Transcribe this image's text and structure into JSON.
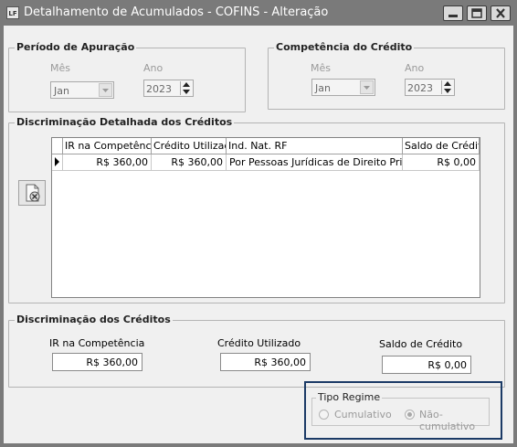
{
  "window": {
    "app_icon_text": "LF",
    "title": "Detalhamento de Acumulados - COFINS - Alteração"
  },
  "periodo": {
    "title": "Período de Apuração",
    "mes_label": "Mês",
    "mes_value": "Jan",
    "ano_label": "Ano",
    "ano_value": "2023"
  },
  "competencia": {
    "title": "Competência do Crédito",
    "mes_label": "Mês",
    "mes_value": "Jan",
    "ano_label": "Ano",
    "ano_value": "2023"
  },
  "detalhada": {
    "title": "Discriminação Detalhada dos Créditos",
    "columns": [
      "IR na Competência",
      "Crédito Utilizado",
      "Ind. Nat. RF",
      "Saldo de Crédito"
    ],
    "rows": [
      [
        "R$ 360,00",
        "R$ 360,00",
        "Por Pessoas Jurídicas de Direito Privado",
        "R$ 0,00"
      ]
    ]
  },
  "creditos": {
    "title": "Discriminação dos Créditos",
    "ir_label": "IR na Competência",
    "ir_value": "R$ 360,00",
    "utilizado_label": "Crédito Utilizado",
    "utilizado_value": "R$ 360,00",
    "saldo_label": "Saldo de Crédito",
    "saldo_value": "R$ 0,00"
  },
  "regime": {
    "title": "Tipo Regime",
    "option_cumulativo": "Cumulativo",
    "option_nao_cumulativo": "Não-cumulativo",
    "selected": "Não-cumulativo"
  },
  "colors": {
    "titlebar": "#7a7a7a",
    "client": "#f0f0f0",
    "highlight_border": "#1b3a66"
  }
}
